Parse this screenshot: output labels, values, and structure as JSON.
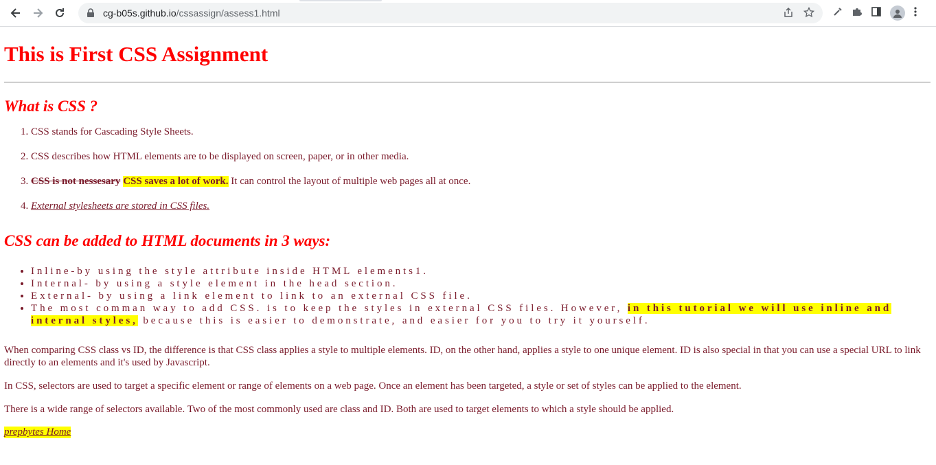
{
  "browser": {
    "url_host": "cg-b05s.github.io",
    "url_path": "/cssassign/assess1.html"
  },
  "page": {
    "title": "This is First CSS Assignment",
    "section1_heading": "What is CSS ?",
    "section1_items": {
      "item1": "CSS stands for Cascading Style Sheets.",
      "item2": "CSS describes how HTML elements are to be displayed on screen, paper, or in other media.",
      "item3_strike": "CSS is not nessesary",
      "item3_highlight": "CSS saves a lot of work.",
      "item3_rest": " It can control the layout of multiple web pages all at once.",
      "item4": "External stylesheets are stored in CSS files."
    },
    "section2_heading": "CSS can be added to HTML documents in 3 ways:",
    "section2_items": {
      "inline": "Inline-by using the style attribute inside HTML elements1.",
      "internal": "Internal- by using a style element in the head section.",
      "external": "External- by using a link element to link to an external CSS file.",
      "common_start": "The most comman way to add CSS. is to keep the styles in external CSS files. However, ",
      "common_highlight": "in this tutorial we will use inline and internal styles,",
      "common_end": " because this is easier to demonstrate, and easier for you to try it yourself."
    },
    "paragraphs": {
      "p1": "When comparing CSS class vs ID, the difference is that CSS class applies a style to multiple elements. ID, on the other hand, applies a style to one unique element. ID is also special in that you can use a special URL to link directly to an elements and it's used by Javascript.",
      "p2": "In CSS, selectors are used to target a specific element or range of elements on a web page. Once an element has been targeted, a style or set of styles can be applied to the element.",
      "p3": "There is a wide range of selectors available. Two of the most commonly used are class and ID. Both are used to target elements to which a style should be applied."
    },
    "home_link": "prepbytes Home"
  },
  "colors": {
    "heading": "#ff0000",
    "text": "#7a1a2a",
    "highlight": "#ffff00"
  }
}
